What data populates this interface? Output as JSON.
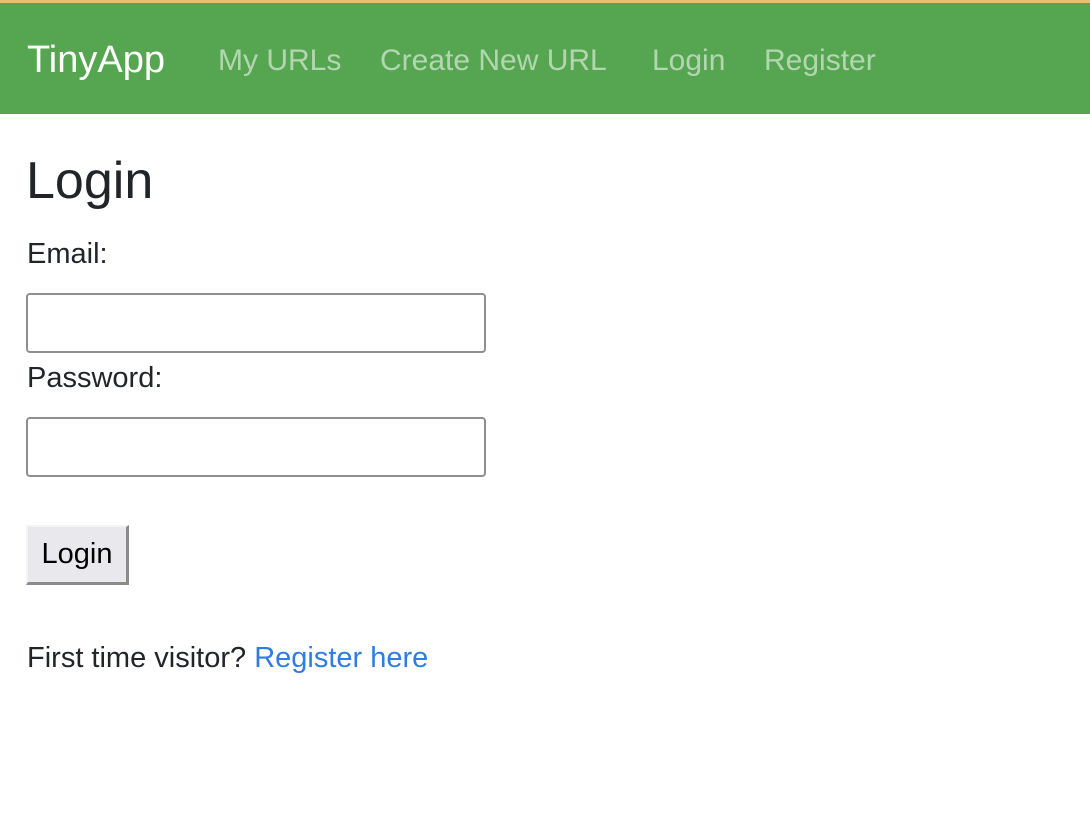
{
  "navbar": {
    "brand": "TinyApp",
    "links": [
      {
        "label": "My URLs"
      },
      {
        "label": "Create New URL"
      },
      {
        "label": "Login"
      },
      {
        "label": "Register"
      }
    ],
    "background": "#56a651",
    "top_border_color": "#e3c26a"
  },
  "page": {
    "title": "Login"
  },
  "form": {
    "email_label": "Email:",
    "email_value": "",
    "password_label": "Password:",
    "password_value": "",
    "submit_label": "Login"
  },
  "footer": {
    "prompt": "First time visitor?",
    "register_link": "Register here",
    "link_color": "#2f7de1"
  }
}
